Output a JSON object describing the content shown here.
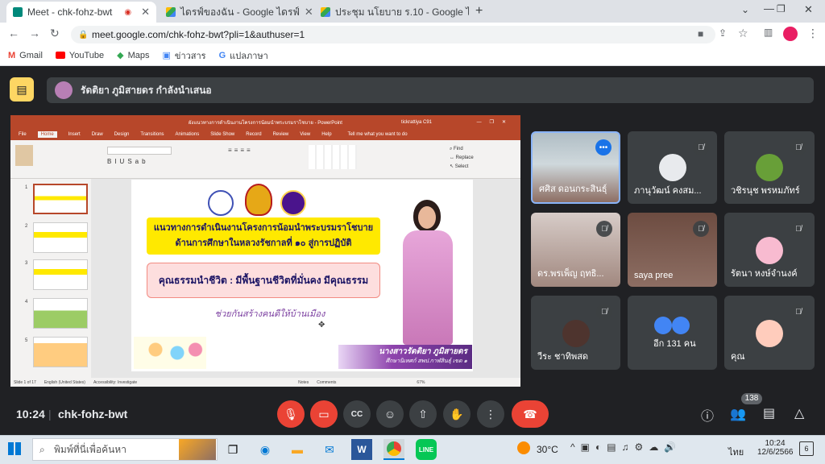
{
  "browser": {
    "tabs": [
      {
        "title": "Meet - chk-fohz-bwt"
      },
      {
        "title": "ไดรฟ์ของฉัน - Google ไดรฟ์"
      },
      {
        "title": "ประชุม นโยบาย ร.10 - Google ไดรฟ์"
      }
    ],
    "url": "meet.google.com/chk-fohz-bwt?pli=1&authuser=1",
    "bookmarks": [
      "Gmail",
      "YouTube",
      "Maps",
      "ข่าวสาร",
      "แปลภาษา"
    ]
  },
  "meet": {
    "presenting_banner": "รัดติยา ภูมิสายดร กำลังนำเสนอ",
    "participants": [
      {
        "name": "ศศิส ดอนกระสินธุ์"
      },
      {
        "name": "ภานุวัฒน์ คงสม..."
      },
      {
        "name": "วชิรนุช พรหมภัทร์"
      },
      {
        "name": "ดร.พรเพ็ญ ฤทธิ..."
      },
      {
        "name": "saya pree"
      },
      {
        "name": "รัตนา หงษ์จำนงค์"
      },
      {
        "name": "วีระ ชาทิพสด"
      },
      {
        "name": "อีก 131 คน"
      },
      {
        "name": "คุณ"
      }
    ],
    "time": "10:24",
    "meeting_code": "chk-fohz-bwt",
    "participant_count": "138"
  },
  "ppt": {
    "window_title": "ผังแนวทางการดำเนินงานโครงการน้อมนำพระบรมราโชบาย - PowerPoint",
    "user": "tickrattiya C91",
    "tabs": [
      "File",
      "Home",
      "Insert",
      "Draw",
      "Design",
      "Transitions",
      "Animations",
      "Slide Show",
      "Record",
      "Review",
      "View",
      "Help"
    ],
    "tell_me": "Tell me what you want to do",
    "status": [
      "Slide 1 of 17",
      "English (United States)",
      "Accessibility: Investigate",
      "Notes",
      "Comments",
      "67%"
    ],
    "slide": {
      "heading_line1": "แนวทางการดำเนินงานโครงการน้อมนำพระบรมราโชบาย",
      "heading_line2": "ด้านการศึกษาในหลวงรัชกาลที่ ๑๐ สู่การปฏิบัติ",
      "subheading": "คุณธรรมนำชีวิต : มีพื้นฐานชีวิตที่มั่นคง มีคุณธรรม",
      "slogan": "ช่วยกันสร้างคนดีให้บ้านเมือง",
      "presenter_name": "นางสาวรัดติยา ภูมิสายดร",
      "presenter_role": "ศึกษานิเทศก์ สพป.กาฬสินธุ์ เขต ๑"
    }
  },
  "taskbar": {
    "search_placeholder": "พิมพ์ที่นี่เพื่อค้นหา",
    "weather": "30°C",
    "lang": "ไทย",
    "time": "10:24",
    "date": "12/6/2566",
    "notif": "6"
  },
  "colors": {
    "meet_bg": "#202124",
    "tile_bg": "#3c4043",
    "end_call": "#ea4335",
    "ppt_accent": "#b7472a"
  }
}
